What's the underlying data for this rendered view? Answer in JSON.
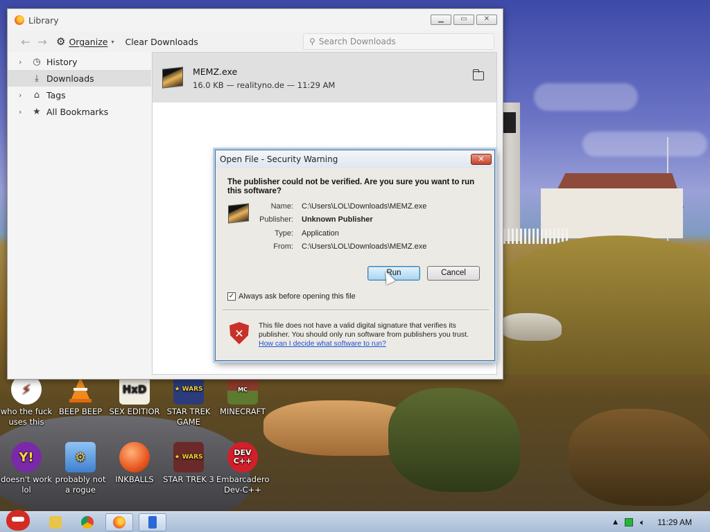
{
  "library": {
    "title": "Library",
    "toolbar": {
      "back_icon": "back-arrow-icon",
      "forward_icon": "forward-arrow-icon",
      "organize_label": "Organize",
      "clear_label": "Clear Downloads",
      "search_placeholder": "Search Downloads"
    },
    "sidebar": {
      "items": [
        {
          "label": "History",
          "icon": "clock-icon",
          "has_twisty": true
        },
        {
          "label": "Downloads",
          "icon": "download-icon",
          "has_twisty": false,
          "selected": true
        },
        {
          "label": "Tags",
          "icon": "tag-icon",
          "has_twisty": true
        },
        {
          "label": "All Bookmarks",
          "icon": "star-icon",
          "has_twisty": true
        }
      ]
    },
    "download": {
      "name": "MEMZ.exe",
      "meta": "16.0 KB — realityno.de — 11:29 AM"
    }
  },
  "dialog": {
    "title": "Open File - Security Warning",
    "question": "The publisher could not be verified.  Are you sure you want to run this software?",
    "fields": [
      {
        "key": "Name:",
        "value": "C:\\Users\\LOL\\Downloads\\MEMZ.exe",
        "bold": false
      },
      {
        "key": "Publisher:",
        "value": "Unknown Publisher",
        "bold": true
      },
      {
        "key": "Type:",
        "value": "Application",
        "bold": false
      },
      {
        "key": "From:",
        "value": "C:\\Users\\LOL\\Downloads\\MEMZ.exe",
        "bold": false
      }
    ],
    "run_label": "Run",
    "cancel_label": "Cancel",
    "checkbox_label": "Always ask before opening this file",
    "checkbox_checked": true,
    "info_text": "This file does not have a valid digital signature that verifies its publisher.  You should only run software from publishers you trust.",
    "link_text": "How can I decide what software to run?"
  },
  "desktop_icons": [
    {
      "label": "who the fuck uses this",
      "icon": "lightning-icon",
      "color": "#e04a2a"
    },
    {
      "label": "BEEP BEEP",
      "icon": "vlc-cone-icon",
      "color": "#f08a1c"
    },
    {
      "label": "SEX EDITIOR",
      "icon": "hex-editor-icon",
      "color": "#f2efe2"
    },
    {
      "label": "STAR TREK GAME",
      "icon": "star-wars-icon",
      "color": "#2a3c7c"
    },
    {
      "label": "MINECRAFT",
      "icon": "minecraft-icon",
      "color": "#8b3a2a"
    },
    {
      "label": "doesn't work lol",
      "icon": "yahoo-messenger-icon",
      "color": "#7a2aa8"
    },
    {
      "label": "probably not a rogue",
      "icon": "settings-gears-icon",
      "color": "#4c8fd6"
    },
    {
      "label": "INKBALLS",
      "icon": "inkball-icon",
      "color": "#e8571e"
    },
    {
      "label": "STAR TREK 3",
      "icon": "star-wars-icon",
      "color": "#6a2a2a"
    },
    {
      "label": "Embarcadero Dev-C++",
      "icon": "devcpp-icon",
      "color": "#d21f2a",
      "glyph": "DEV C++"
    }
  ],
  "taskbar": {
    "clock": "11:29 AM",
    "items": [
      {
        "icon": "file-explorer-icon",
        "color": "#e9c44a"
      },
      {
        "icon": "chrome-icon",
        "color": "#3aa757"
      },
      {
        "icon": "firefox-icon",
        "color": "#ff7a1a",
        "active": true
      },
      {
        "icon": "notepad-icon",
        "color": "#2a6ad6",
        "active": true
      }
    ],
    "tray": {
      "up_arrow_icon": "show-hidden-icons",
      "battery_icon": "battery-icon",
      "volume_icon": "volume-icon"
    }
  }
}
